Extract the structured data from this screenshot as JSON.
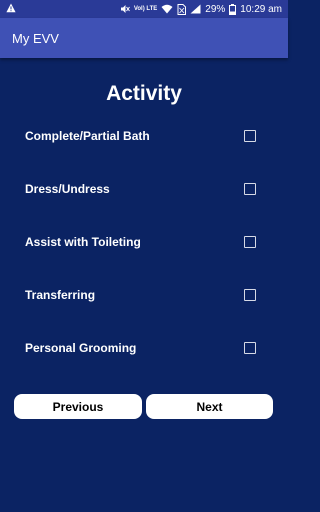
{
  "status_bar": {
    "vol_lte_label": "Vol) LTE",
    "battery": "29%",
    "time": "10:29 am"
  },
  "app_bar": {
    "title": "My EVV"
  },
  "main": {
    "title": "Activity",
    "items": [
      {
        "label": "Complete/Partial Bath",
        "checked": false
      },
      {
        "label": "Dress/Undress",
        "checked": false
      },
      {
        "label": "Assist with Toileting",
        "checked": false
      },
      {
        "label": "Transferring",
        "checked": false
      },
      {
        "label": "Personal Grooming",
        "checked": false
      }
    ]
  },
  "buttons": {
    "previous": "Previous",
    "next": "Next"
  },
  "colors": {
    "background": "#0b2363",
    "status_bar": "#2a3a97",
    "app_bar": "#3f51b5",
    "button_bg": "#ffffff"
  }
}
